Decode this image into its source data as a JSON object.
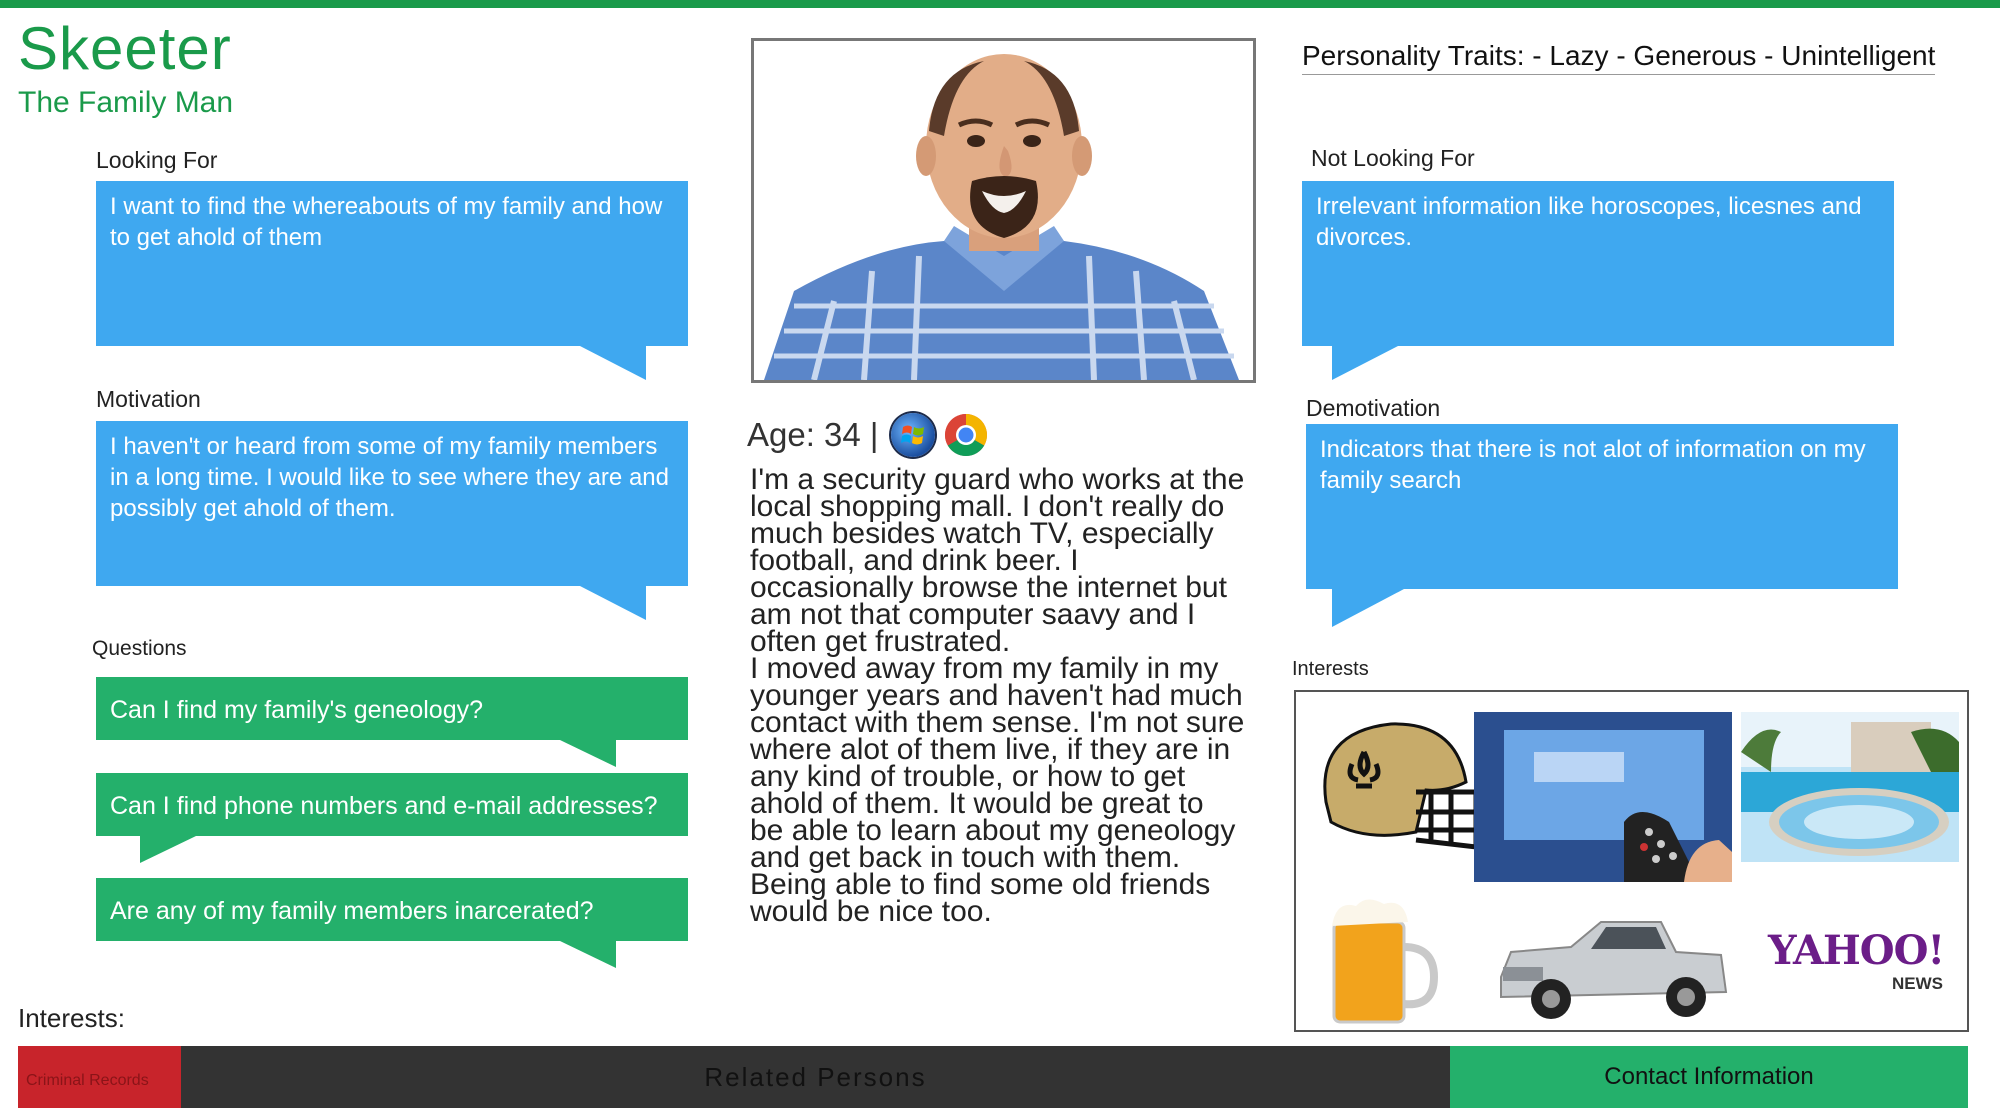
{
  "persona": {
    "name": "Skeeter",
    "tagline": "The Family Man",
    "age_text": "Age: 34 |",
    "personality": "Personality Traits: - Lazy - Generous - Unintelligent"
  },
  "left": {
    "looking_for_label": "Looking For",
    "looking_for_text": "I want to find the whereabouts of my family and how to get ahold of them",
    "motivation_label": "Motivation",
    "motivation_text": "I haven't or heard from some of my family members in a long time. I would like to see where they are and possibly get ahold of them.",
    "questions_label": "Questions",
    "questions": [
      "Can I find my family's geneology?",
      "Can I find phone numbers and e-mail addresses?",
      "Are any of my family members inarcerated?"
    ]
  },
  "right": {
    "not_looking_label": "Not Looking For",
    "not_looking_text": "Irrelevant information like horoscopes, licesnes and divorces.",
    "demotivation_label": "Demotivation",
    "demotivation_text": "Indicators that there is not alot of information on my family search",
    "interests_label": "Interests",
    "interest_images": [
      "football-helmet",
      "tv-remote",
      "resort-pool",
      "beer-mug",
      "pickup-truck",
      "yahoo-news"
    ],
    "yahoo_logo": "YAHOO!",
    "yahoo_sub": "NEWS"
  },
  "bio": [
    "I'm a security guard who works at the",
    "local shopping mall.  I don't really do",
    "much besides watch TV, especially",
    "football, and drink beer. I",
    "occasionally browse the internet but",
    "am not that computer saavy and I",
    "often get frustrated.",
    "I moved away from my family in my",
    "younger years and haven't had much",
    "contact with them sense. I'm not sure",
    "where alot of them live, if they are in",
    "any kind of trouble, or how to get",
    "ahold of them. It would be great to",
    "be able to learn about my geneology",
    "and get back in touch with them.",
    "Being able to find some old friends",
    "would be nice too."
  ],
  "footer": {
    "interests_label": "Interests:",
    "tab_criminal": "Criminal Records",
    "tab_related": "Related Persons",
    "tab_contact": "Contact Information"
  },
  "colors": {
    "brand_green": "#1a9a4a",
    "bubble_blue": "#3fa8f0",
    "bubble_green": "#24b06b",
    "tab_red": "#c8242b",
    "bar_dark": "#333333"
  }
}
